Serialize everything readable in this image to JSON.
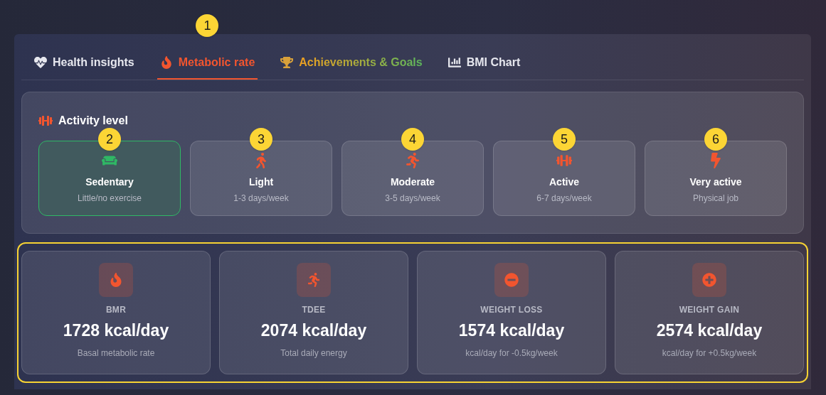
{
  "tabs": [
    {
      "label": "Health insights",
      "kind": "plain",
      "selected": false
    },
    {
      "label": "Metabolic rate",
      "kind": "plain",
      "selected": true,
      "marker": "1"
    },
    {
      "label": "Achievements & Goals",
      "kind": "gradient",
      "selected": false
    },
    {
      "label": "BMI Chart",
      "kind": "plain",
      "selected": false
    }
  ],
  "activity": {
    "title": "Activity level",
    "options": [
      {
        "label": "Sedentary",
        "note": "Little/no exercise",
        "selected": true,
        "marker": "2"
      },
      {
        "label": "Light",
        "note": "1-3 days/week",
        "selected": false,
        "marker": "3"
      },
      {
        "label": "Moderate",
        "note": "3-5 days/week",
        "selected": false,
        "marker": "4"
      },
      {
        "label": "Active",
        "note": "6-7 days/week",
        "selected": false,
        "marker": "5"
      },
      {
        "label": "Very active",
        "note": "Physical job",
        "selected": false,
        "marker": "6"
      }
    ]
  },
  "stats": {
    "highlighted": true,
    "cards": [
      {
        "label": "BMR",
        "value": "1728 kcal/day",
        "note": "Basal metabolic rate"
      },
      {
        "label": "TDEE",
        "value": "2074 kcal/day",
        "note": "Total daily energy"
      },
      {
        "label": "WEIGHT LOSS",
        "value": "1574 kcal/day",
        "note": "kcal/day for -0.5kg/week"
      },
      {
        "label": "WEIGHT GAIN",
        "value": "2574 kcal/day",
        "note": "kcal/day for +0.5kg/week"
      }
    ]
  }
}
